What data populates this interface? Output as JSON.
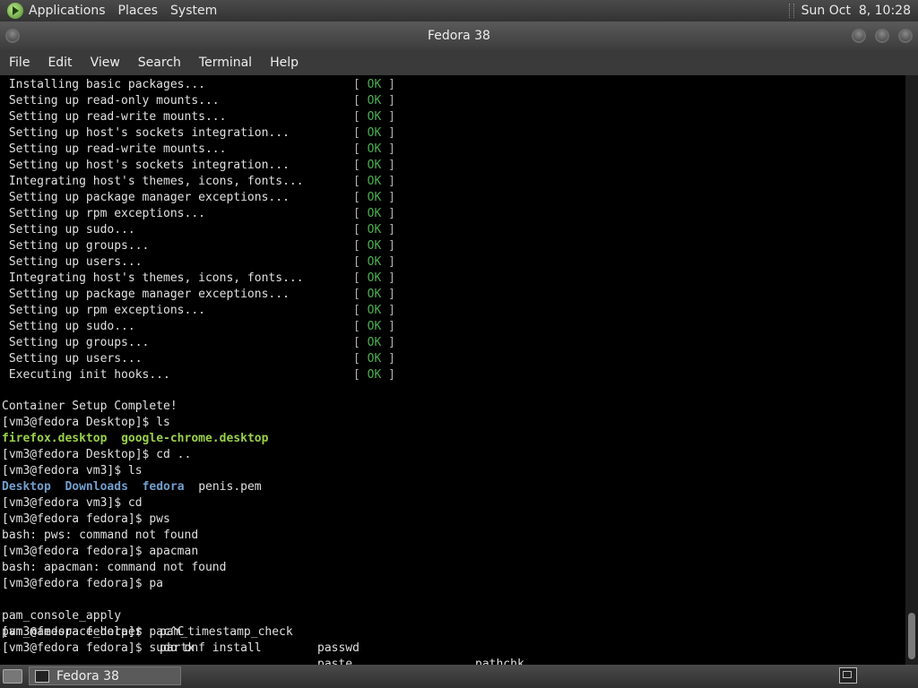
{
  "top_panel": {
    "menus": [
      "Applications",
      "Places",
      "System"
    ],
    "clock": "Sun Oct  8, 10:28"
  },
  "window": {
    "title": "Fedora 38",
    "menus": [
      "File",
      "Edit",
      "View",
      "Search",
      "Terminal",
      "Help"
    ]
  },
  "terminal": {
    "ok_open": "[ ",
    "ok_text": "OK",
    "ok_close": " ]",
    "status_lines": [
      " Installing basic packages...",
      " Setting up read-only mounts...",
      " Setting up read-write mounts...",
      " Setting up host's sockets integration...",
      " Setting up read-write mounts...",
      " Setting up host's sockets integration...",
      " Integrating host's themes, icons, fonts...",
      " Setting up package manager exceptions...",
      " Setting up rpm exceptions...",
      " Setting up sudo...",
      " Setting up groups...",
      " Setting up users...",
      " Integrating host's themes, icons, fonts...",
      " Setting up package manager exceptions...",
      " Setting up rpm exceptions...",
      " Setting up sudo...",
      " Setting up groups...",
      " Setting up users...",
      " Executing init hooks..."
    ],
    "setup_complete": "Container Setup Complete!",
    "cmd_ls_desktop": "[vm3@fedora Desktop]$ ls",
    "desktop_files": [
      "firefox.desktop",
      "google-chrome.desktop"
    ],
    "cmd_cd_up": "[vm3@fedora Desktop]$ cd ..",
    "cmd_ls_vm3": "[vm3@fedora vm3]$ ls",
    "vm3_dirs": [
      "Desktop",
      "Downloads",
      "fedora"
    ],
    "vm3_file": "penis.pem",
    "cmd_cd": "[vm3@fedora vm3]$ cd",
    "cmd_pws": "[vm3@fedora fedora]$ pws",
    "err_pws": "bash: pws: command not found",
    "cmd_apacman": "[vm3@fedora fedora]$ apacman",
    "err_apacman": "bash: apacman: command not found",
    "cmd_pa": "[vm3@fedora fedora]$ pa",
    "completions": [
      [
        "pam_console_apply",
        "pam_timestamp_check",
        "passwd",
        "pathchk"
      ],
      [
        "pam_namespace_helper",
        "partx",
        "paste",
        ""
      ]
    ],
    "cmd_pac": "[vm3@fedora fedora]$ pac^C",
    "cmd_sudo": "[vm3@fedora fedora]$ sudo dnf install"
  },
  "taskbar": {
    "task_label": "Fedora 38"
  }
}
